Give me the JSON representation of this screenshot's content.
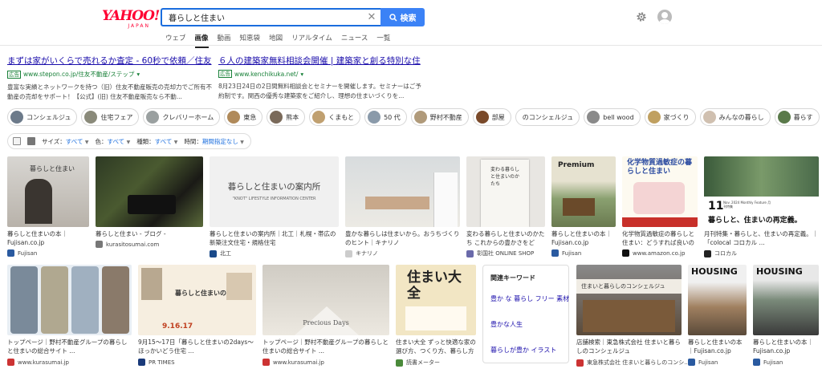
{
  "header": {
    "logo": "YAHOO!",
    "logo_sub": "JAPAN",
    "search_value": "暮らしと住まい",
    "search_button": "検索",
    "tabs": [
      "ウェブ",
      "画像",
      "動画",
      "知恵袋",
      "地図",
      "リアルタイム",
      "ニュース",
      "一覧"
    ],
    "active_tab": "画像"
  },
  "ads": [
    {
      "title": "まずは家がいくらで売れるか査定 - 60秒で依頼／住友",
      "badge": "広告",
      "url": "www.stepon.co.jp/住友不動産/ステップ",
      "desc": "豊富な実績とネットワークを持つ（旧）住友不動産販売の売却力でご所有不動産の売却をサポート！【公式】(旧) 住友不動産販売なら不動..."
    },
    {
      "title": "６人の建築家無料相談会開催 | 建築家と創る特別な住",
      "badge": "広告",
      "url": "www.kenchikuka.net/",
      "desc": "8月23日24日の2日間無料相談会とセミナーを開催します。セミナーはご予約制です。関西の優秀な建築家をご紹介し、理想の住まいづくりを..."
    }
  ],
  "chips": [
    {
      "label": "コンシェルジュ",
      "thumb": true
    },
    {
      "label": "住宅フェア",
      "thumb": true
    },
    {
      "label": "クレバリーホーム",
      "thumb": true
    },
    {
      "label": "東急",
      "thumb": true
    },
    {
      "label": "熊本",
      "thumb": true
    },
    {
      "label": "くまもと",
      "thumb": true
    },
    {
      "label": "50 代",
      "thumb": true
    },
    {
      "label": "野村不動産",
      "thumb": true
    },
    {
      "label": "部屋",
      "thumb": true
    },
    {
      "label": "のコンシェルジュ",
      "thumb": false
    },
    {
      "label": "bell wood",
      "thumb": true
    },
    {
      "label": "家づくり",
      "thumb": true
    },
    {
      "label": "みんなの暮らし",
      "thumb": true
    },
    {
      "label": "暮らす",
      "thumb": true
    }
  ],
  "filters": {
    "size_label": "サイズ：",
    "size_value": "すべて",
    "color_label": "色：",
    "color_value": "すべて",
    "type_label": "種類：",
    "type_value": "すべて",
    "time_label": "時間：",
    "time_value": "期間指定なし"
  },
  "row1": [
    {
      "caption": "暮らしと住まいの本｜Fujisan.co.jp",
      "source": "Fujisan",
      "img_text": "暮らしと住まい"
    },
    {
      "caption": "暮らしと住まい - ブログ -",
      "source": "kurasitosumai.com",
      "img_text": ""
    },
    {
      "caption": "暮らしと住まいの案内所｜北工｜札幌・帯広の新築注文住宅・規格住宅",
      "source": "北工",
      "img_text": "暮らしと住まいの案内所",
      "img_sub": "\"KNOT\" LIFESTYLE INFORMATION CENTER"
    },
    {
      "caption": "豊かな暮らしは住まいから。おうちづくりのヒント｜キナリノ",
      "source": "キナリノ",
      "img_text": ""
    },
    {
      "caption": "変わる暮らしと住まいのかたち これからの豊かさをどう...",
      "source": "彰国社 ONLINE SHOP",
      "img_text": "変わる暮らしと住まいのかたち"
    },
    {
      "caption": "暮らしと住まいの本｜Fujisan.co.jp",
      "source": "Fujisan",
      "img_text": "Premium"
    },
    {
      "caption": "化学物質過敏症の暮らしと住まい：どうすれば良いのか...",
      "source": "www.amazon.co.jp",
      "img_text": "化学物質過敏症の暮らしと住まい"
    },
    {
      "caption": "月刊特集・暮らしと、住まいの再定義。｜「colocal コロカル ...",
      "source": "コロカル",
      "img_text": "暮らしと、住まいの再定義。",
      "img_num": "11",
      "img_small": "Nov. 2024 Monthly Feature 月刊特集"
    }
  ],
  "row2": [
    {
      "caption": "トップページ｜野村不動産グループの暮らしと住まいの総合サイト ...",
      "source": "www.kurasumai.jp"
    },
    {
      "caption": "9月15〜17日「暮らしと住まいの2days〜ほっかいどう住宅 ...",
      "source": "PR TIMES",
      "img_text": "暮らしと住まいの2days",
      "img_date": "9.16.17"
    },
    {
      "caption": "トップページ｜野村不動産グループの暮らしと住まいの総合サイト ...",
      "source": "www.kurasumai.jp",
      "img_text": "Precious Days"
    },
    {
      "caption": "住まい大全 ずっと快適な家の選び方、つくり方、暮らし方 ...",
      "source": "読書メーター",
      "img_text": "住まい大全"
    },
    {
      "caption": "店舗検索｜東急株式会社 住まいと暮らしのコンシェルジュ",
      "source": "東急株式会社 住まいと暮らしのコンシ...",
      "img_text": "住まいと暮らしのコンシェルジュ"
    },
    {
      "caption": "暮らしと住まいの本｜Fujisan.co.jp",
      "source": "Fujisan",
      "img_text": "HOUSING"
    },
    {
      "caption": "暮らしと住まいの本｜Fujisan.co.jp",
      "source": "Fujisan",
      "img_text": "HOUSING"
    }
  ],
  "related": {
    "title": "関連キーワード",
    "items": [
      "豊か な 暮らし フリー 素材",
      "豊かな人生",
      "暮らしが豊か イラスト"
    ]
  }
}
